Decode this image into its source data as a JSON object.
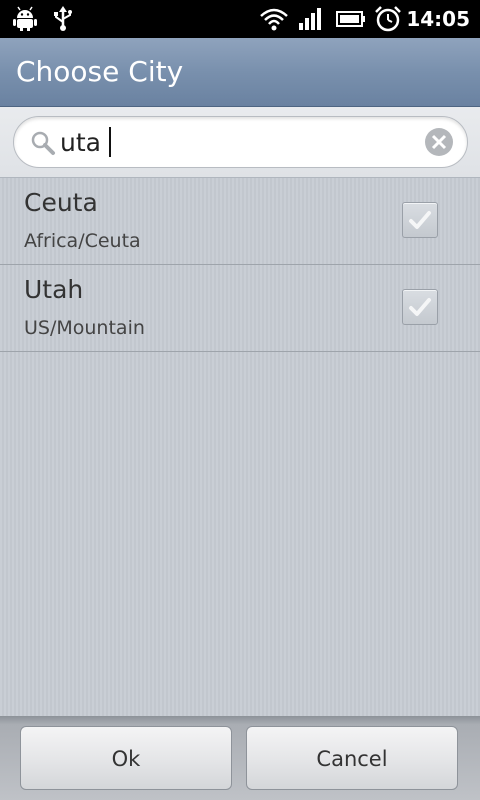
{
  "status_bar": {
    "time": "14:05",
    "icons": [
      "android-debug-icon",
      "usb-icon",
      "wifi-icon",
      "signal-icon",
      "battery-icon",
      "alarm-icon"
    ]
  },
  "dialog": {
    "title": "Choose City"
  },
  "search": {
    "value": "uta",
    "placeholder": ""
  },
  "cities": [
    {
      "name": "Ceuta",
      "zone": "Africa/Ceuta",
      "checked": true
    },
    {
      "name": "Utah",
      "zone": "US/Mountain",
      "checked": true
    }
  ],
  "buttons": {
    "ok": "Ok",
    "cancel": "Cancel"
  },
  "colors": {
    "title_bar": "#7990ad",
    "list_bg": "#c7ccd3",
    "status_bar": "#000000"
  }
}
